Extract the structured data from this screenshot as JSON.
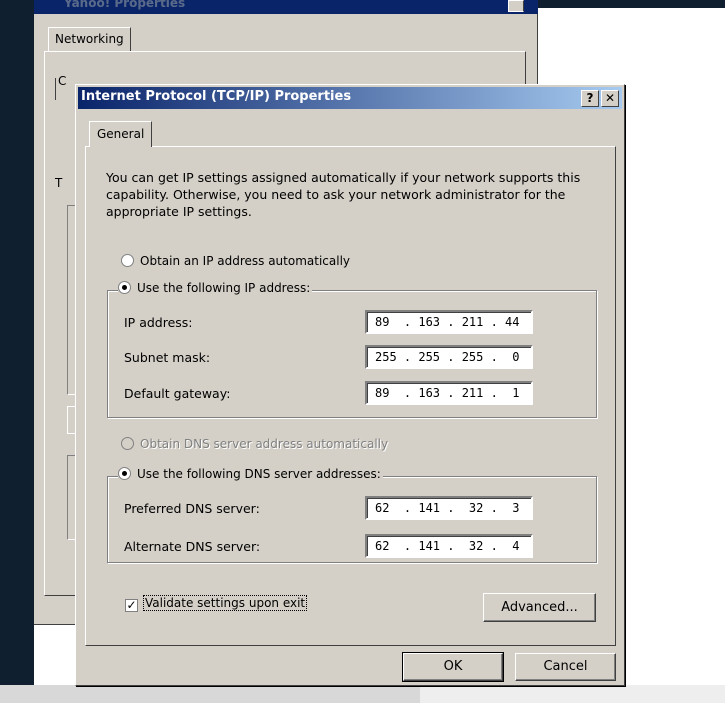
{
  "background_dialog": {
    "title": "Yahoo! Properties",
    "tab_label": "Networking"
  },
  "dialog": {
    "title": "Internet Protocol (TCP/IP) Properties",
    "help_button": "?",
    "close_button": "✕",
    "tab_label": "General",
    "intro_text": "You can get IP settings assigned automatically if your network supports this capability. Otherwise, you need to ask your network administrator for the appropriate IP settings.",
    "ip_auto_label": "Obtain an IP address automatically",
    "ip_manual_label": "Use the following IP address:",
    "ip_address_label": "IP address:",
    "ip_address_value": "89  . 163 . 211 . 44",
    "subnet_label": "Subnet mask:",
    "subnet_value": "255 . 255 . 255 .  0",
    "gateway_label": "Default gateway:",
    "gateway_value": "89  . 163 . 211 .  1",
    "dns_auto_label": "Obtain DNS server address automatically",
    "dns_manual_label": "Use the following DNS server addresses:",
    "preferred_dns_label": "Preferred DNS server:",
    "preferred_dns_value": "62  . 141 .  32 .  3",
    "alternate_dns_label": "Alternate DNS server:",
    "alternate_dns_value": "62  . 141 .  32 .  4",
    "validate_label": "Validate settings upon exit",
    "validate_checked": true,
    "advanced_button": "Advanced...",
    "ok_button": "OK",
    "cancel_button": "Cancel"
  },
  "colors": {
    "titlebar_start": "#0a246a",
    "titlebar_end": "#a6caf0",
    "dialog_face": "#d4d0c8",
    "desktop": "#0f1f2f"
  }
}
